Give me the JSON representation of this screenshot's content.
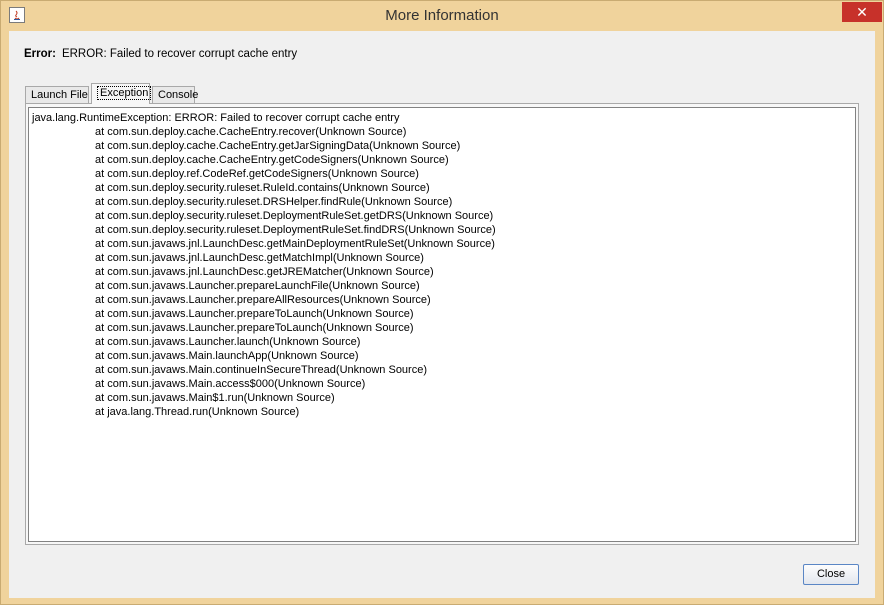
{
  "window": {
    "title": "More Information",
    "close_glyph": "✕"
  },
  "error": {
    "label": "Error:",
    "message": "ERROR: Failed to recover corrupt cache entry"
  },
  "tabs": [
    {
      "label": "Launch File",
      "selected": false
    },
    {
      "label": "Exception",
      "selected": true
    },
    {
      "label": "Console",
      "selected": false
    }
  ],
  "exception": {
    "header": "java.lang.RuntimeException: ERROR: Failed to recover corrupt cache entry",
    "frames": [
      "at com.sun.deploy.cache.CacheEntry.recover(Unknown Source)",
      "at com.sun.deploy.cache.CacheEntry.getJarSigningData(Unknown Source)",
      "at com.sun.deploy.cache.CacheEntry.getCodeSigners(Unknown Source)",
      "at com.sun.deploy.ref.CodeRef.getCodeSigners(Unknown Source)",
      "at com.sun.deploy.security.ruleset.RuleId.contains(Unknown Source)",
      "at com.sun.deploy.security.ruleset.DRSHelper.findRule(Unknown Source)",
      "at com.sun.deploy.security.ruleset.DeploymentRuleSet.getDRS(Unknown Source)",
      "at com.sun.deploy.security.ruleset.DeploymentRuleSet.findDRS(Unknown Source)",
      "at com.sun.javaws.jnl.LaunchDesc.getMainDeploymentRuleSet(Unknown Source)",
      "at com.sun.javaws.jnl.LaunchDesc.getMatchImpl(Unknown Source)",
      "at com.sun.javaws.jnl.LaunchDesc.getJREMatcher(Unknown Source)",
      "at com.sun.javaws.Launcher.prepareLaunchFile(Unknown Source)",
      "at com.sun.javaws.Launcher.prepareAllResources(Unknown Source)",
      "at com.sun.javaws.Launcher.prepareToLaunch(Unknown Source)",
      "at com.sun.javaws.Launcher.prepareToLaunch(Unknown Source)",
      "at com.sun.javaws.Launcher.launch(Unknown Source)",
      "at com.sun.javaws.Main.launchApp(Unknown Source)",
      "at com.sun.javaws.Main.continueInSecureThread(Unknown Source)",
      "at com.sun.javaws.Main.access$000(Unknown Source)",
      "at com.sun.javaws.Main$1.run(Unknown Source)",
      "at java.lang.Thread.run(Unknown Source)"
    ]
  },
  "buttons": {
    "close_label": "Close"
  },
  "colors": {
    "frame": "#f0d39c",
    "close_button": "#c7312a",
    "button_border": "#5a86c5"
  }
}
